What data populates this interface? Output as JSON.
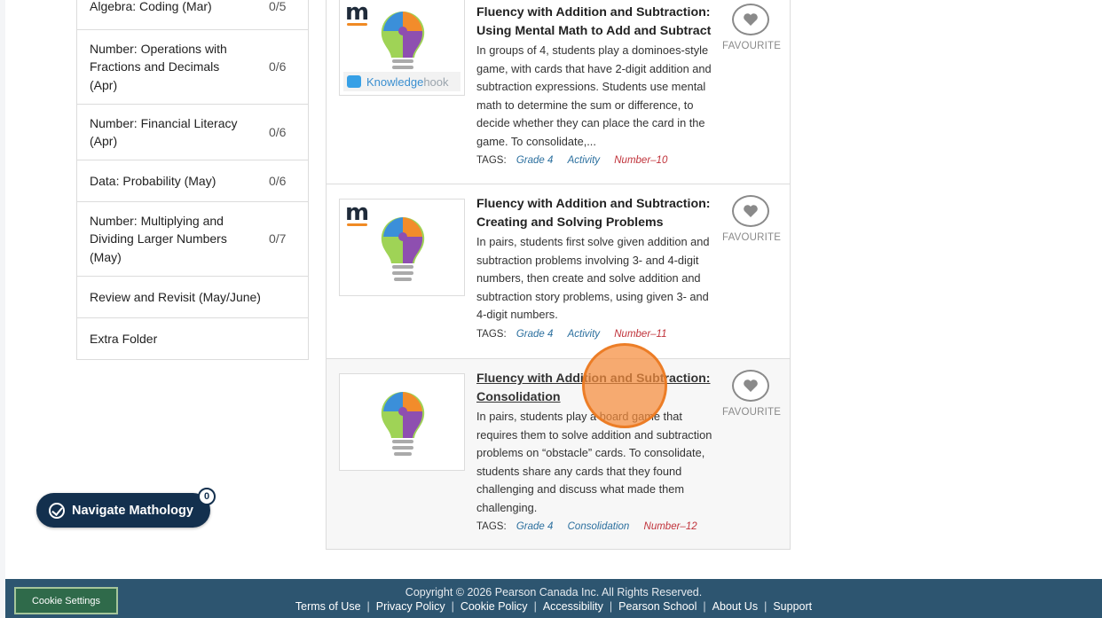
{
  "sidebar": {
    "items": [
      {
        "label": "Algebra: Coding (Mar)",
        "count": "0/5"
      },
      {
        "label": "Number: Operations with Fractions and Decimals (Apr)",
        "count": "0/6"
      },
      {
        "label": "Number: Financial Literacy (Apr)",
        "count": "0/6"
      },
      {
        "label": "Data: Probability (May)",
        "count": "0/6"
      },
      {
        "label": "Number: Multiplying and Dividing Larger Numbers (May)",
        "count": "0/7"
      },
      {
        "label": "Review and Revisit (May/June)",
        "count": ""
      },
      {
        "label": "Extra Folder",
        "count": ""
      }
    ]
  },
  "cards": [
    {
      "title": "Fluency with Addition and Subtraction: Using Mental Math to Add and Subtract",
      "description": "In groups of 4, students play a dominoes-style game, with cards that have 2-digit addition and subtraction expressions. Students use mental math to determine the sum or difference, to decide whether they can place the card in the game. To consolidate,...",
      "tags_label": "TAGS:",
      "tags": [
        "Grade 4",
        "Activity",
        "Number–10"
      ],
      "badge": {
        "part1": "Knowledge",
        "part2": "hook"
      },
      "favourite": "FAVOURITE"
    },
    {
      "title": "Fluency with Addition and Subtraction: Creating and Solving Problems",
      "description": "In pairs, students first solve given addition and subtraction problems involving 3- and 4-digit numbers, then create and solve addition and subtraction story problems, using given 3- and 4-digit numbers.",
      "tags_label": "TAGS:",
      "tags": [
        "Grade 4",
        "Activity",
        "Number–11"
      ],
      "favourite": "FAVOURITE"
    },
    {
      "title": "Fluency with Addition and Subtraction: Consolidation",
      "description": "In pairs, students play a board game that requires them to solve addition and subtraction problems on “obstacle” cards. To consolidate, students share any cards that they found challenging and discuss what made them challenging.",
      "tags_label": "TAGS:",
      "tags": [
        "Grade 4",
        "Consolidation",
        "Number–12"
      ],
      "favourite": "FAVOURITE"
    }
  ],
  "navigate": {
    "label": "Navigate Mathology",
    "badge": "0"
  },
  "footer": {
    "cookie_settings": "Cookie Settings",
    "copyright": "Copyright © 2026 Pearson Canada Inc. All Rights Reserved.",
    "links": [
      "Terms of Use",
      "Privacy Policy",
      "Cookie Policy",
      "Accessibility",
      "Pearson School",
      "About Us",
      "Support"
    ]
  },
  "colors": {
    "navy": "#13304e",
    "footer": "#2d5570",
    "tag_blue": "#2b6f9e",
    "tag_red": "#c0323a",
    "click_indicator": "#f58c3c"
  }
}
